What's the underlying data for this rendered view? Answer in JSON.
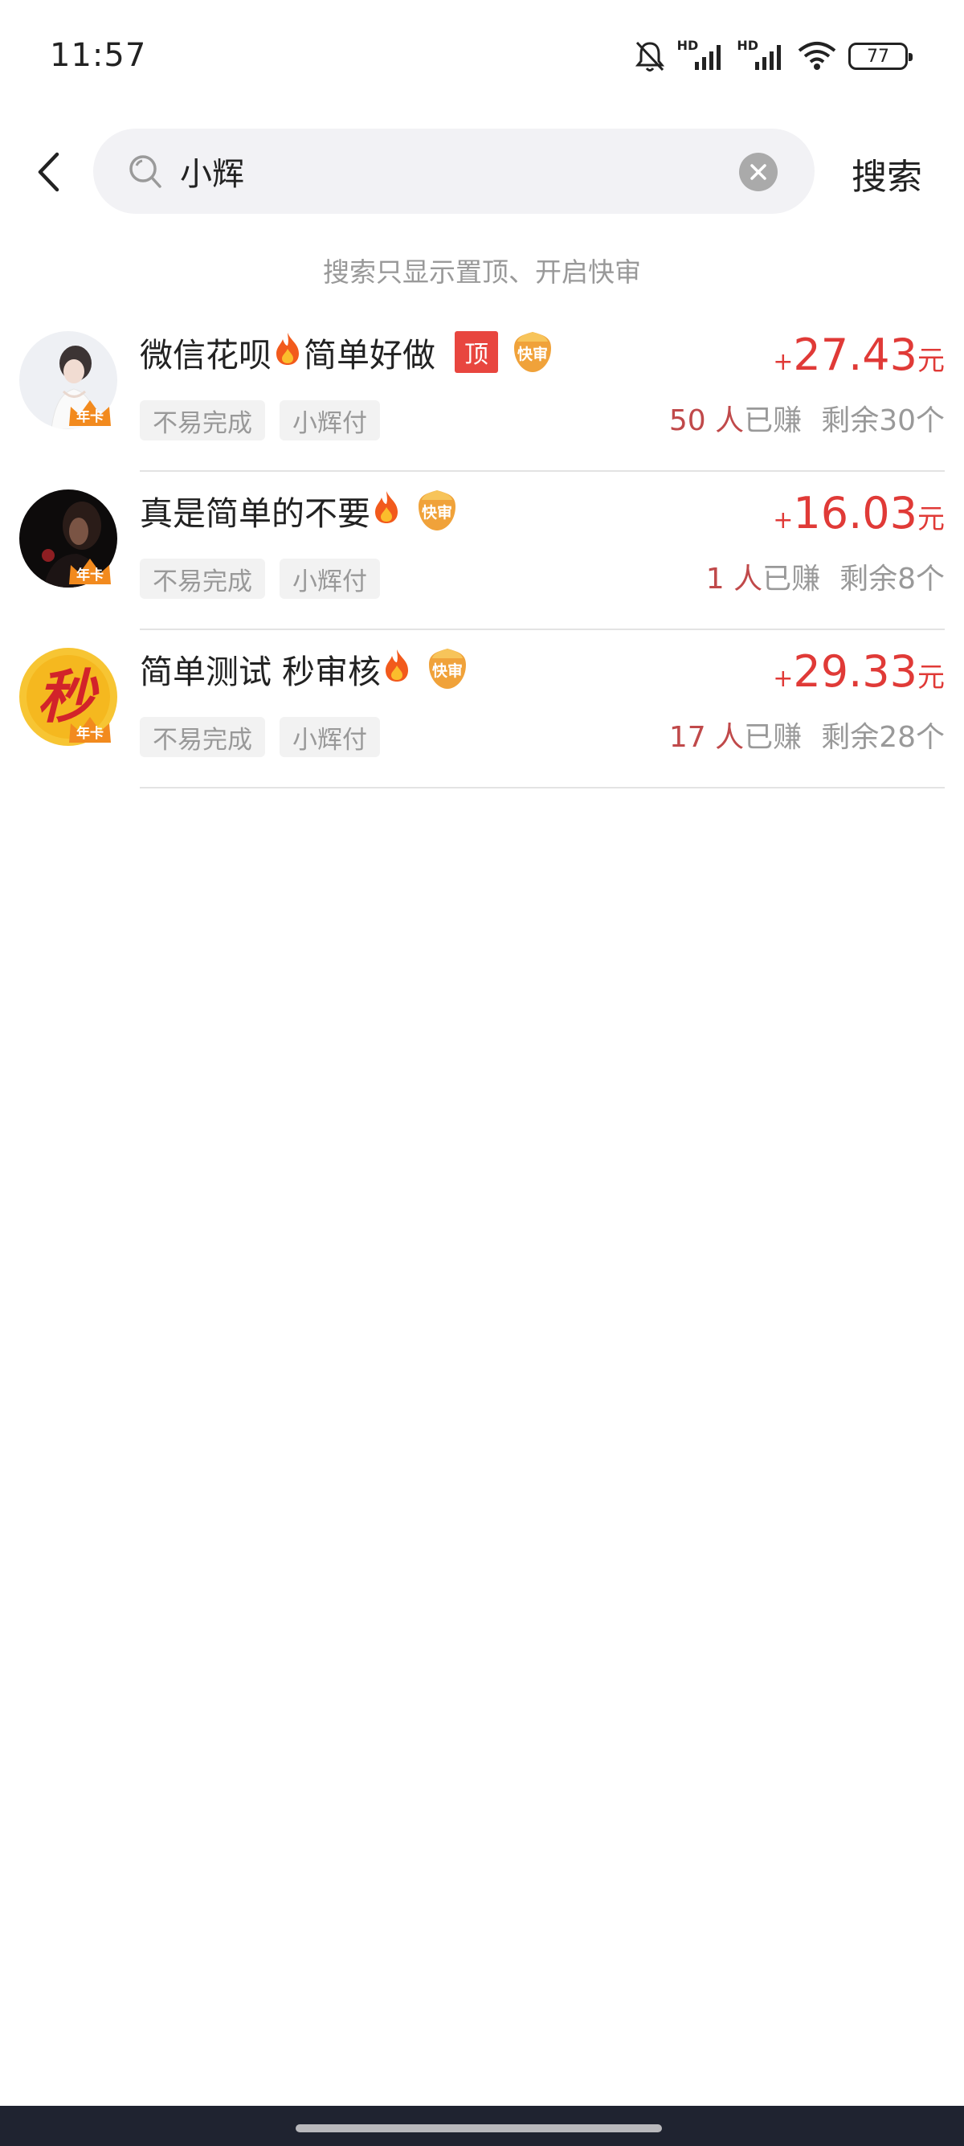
{
  "status_bar": {
    "time": "11:57",
    "hd1": "HD",
    "hd2": "HD",
    "battery": "77",
    "icons": [
      "bell-off-icon",
      "signal-icon",
      "signal-icon",
      "wifi-icon",
      "battery-icon"
    ]
  },
  "search": {
    "query": "小辉",
    "submit_label": "搜索",
    "hint": "搜索只显示置顶、开启快审"
  },
  "colors": {
    "accent_red": "#e03a37",
    "top_tag": "#e8463f",
    "quick_tag": "#f0a23a"
  },
  "tasks": [
    {
      "title_part1": "微信花呗",
      "title_part2": "简单好做",
      "top_label": "顶",
      "quick_label": "快审",
      "badge": "年卡",
      "tags": [
        "不易完成",
        "小辉付"
      ],
      "price_plus": "+",
      "price": "27.43",
      "price_unit": "元",
      "earned_count": "50 人",
      "earned_label": "已赚",
      "remaining": "剩余30个"
    },
    {
      "title_part1": "真是简单的不要",
      "title_part2": "",
      "quick_label": "快审",
      "badge": "年卡",
      "tags": [
        "不易完成",
        "小辉付"
      ],
      "price_plus": "+",
      "price": "16.03",
      "price_unit": "元",
      "earned_count": "1 人",
      "earned_label": "已赚",
      "remaining": "剩余8个"
    },
    {
      "title_part1": "简单测试 秒审核",
      "title_part2": "",
      "quick_label": "快审",
      "badge": "年卡",
      "avatar_char": "秒",
      "tags": [
        "不易完成",
        "小辉付"
      ],
      "price_plus": "+",
      "price": "29.33",
      "price_unit": "元",
      "earned_count": "17 人",
      "earned_label": "已赚",
      "remaining": "剩余28个"
    }
  ]
}
